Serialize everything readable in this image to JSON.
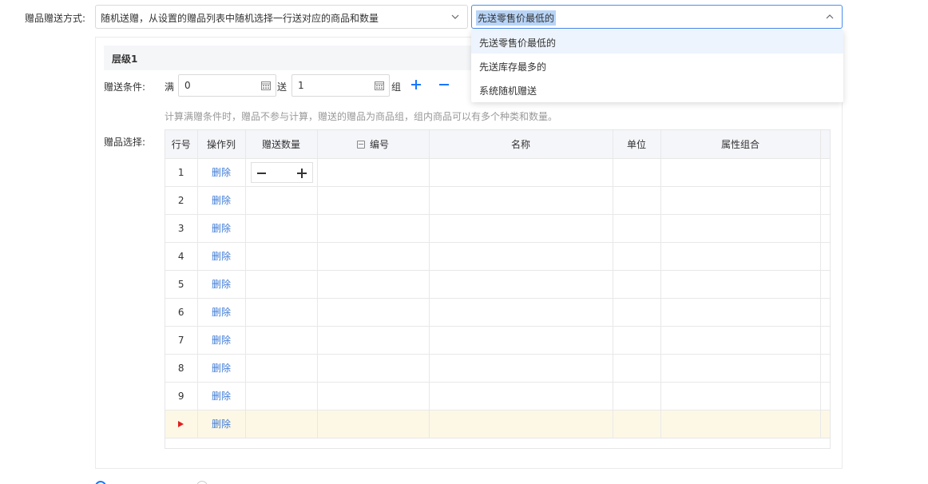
{
  "form": {
    "gift_mode_label": "赠品赠送方式:",
    "gift_mode_value": "随机送赠，从设置的赠品列表中随机选择一行送对应的商品和数量",
    "rule_value": "先送零售价最低的"
  },
  "dropdown": {
    "options": [
      "先送零售价最低的",
      "先送库存最多的",
      "系统随机赠送"
    ]
  },
  "level": {
    "title": "层级1",
    "condition_label": "赠送条件:",
    "man_label": "满",
    "man_value": "0",
    "song_label": "送",
    "song_value": "1",
    "zu_label": "组",
    "hint": "计算满赠条件时，赠品不参与计算，赠送的赠品为商品组，组内商品可以有多个种类和数量。",
    "gift_select_label": "赠品选择:"
  },
  "table": {
    "headers": [
      "行号",
      "操作列",
      "赠送数量",
      "编号",
      "名称",
      "单位",
      "属性组合"
    ],
    "rows": [
      {
        "no": "1",
        "action": "删除"
      },
      {
        "no": "2",
        "action": "删除"
      },
      {
        "no": "3",
        "action": "删除"
      },
      {
        "no": "4",
        "action": "删除"
      },
      {
        "no": "5",
        "action": "删除"
      },
      {
        "no": "6",
        "action": "删除"
      },
      {
        "no": "7",
        "action": "删除"
      },
      {
        "no": "8",
        "action": "删除"
      },
      {
        "no": "9",
        "action": "删除"
      },
      {
        "no": "",
        "action": "删除"
      }
    ]
  },
  "colors": {
    "accent": "#1677ff",
    "link": "#3e7bd6",
    "active_row": "#fdf8e6",
    "marker": "#e02020"
  },
  "icons": {
    "select_arrow": "chevron-down-icon",
    "rule_arrow": "chevron-up-icon",
    "calendar": "calendar-icon",
    "add": "plus-icon",
    "remove": "minus-icon",
    "current_row": "triangle-right-icon"
  }
}
